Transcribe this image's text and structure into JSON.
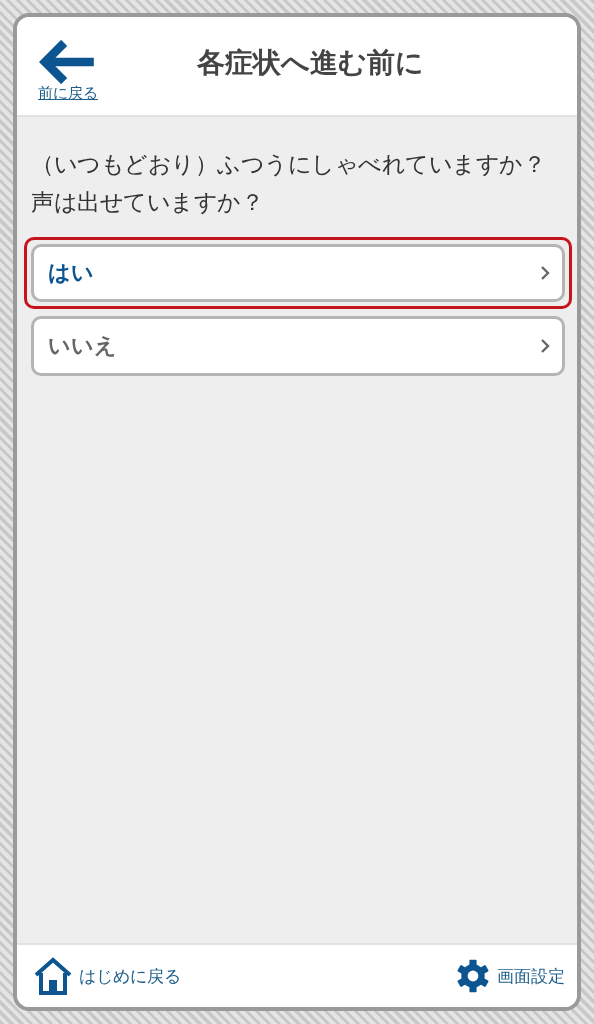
{
  "header": {
    "back_label": "前に戻る",
    "title": "各症状へ進む前に"
  },
  "question": "（いつもどおり）ふつうにしゃべれていますか？声は出せていますか？",
  "options": [
    {
      "label": "はい",
      "selected": true
    },
    {
      "label": "いいえ",
      "selected": false
    }
  ],
  "footer": {
    "home_label": "はじめに戻る",
    "settings_label": "画面設定"
  }
}
